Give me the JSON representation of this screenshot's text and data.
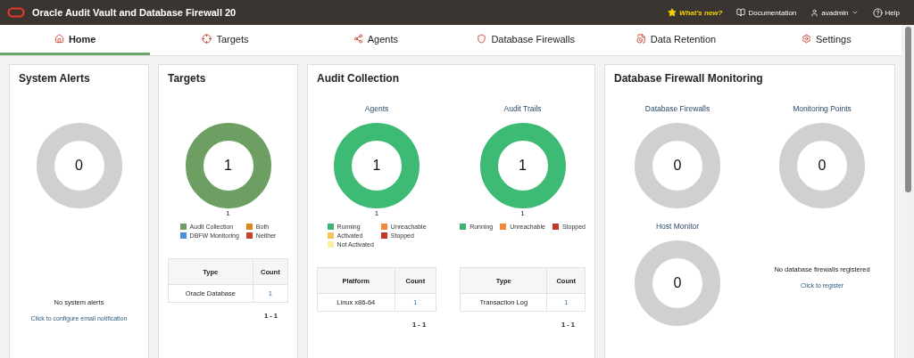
{
  "header": {
    "title": "Oracle Audit Vault and Database Firewall 20",
    "links": [
      {
        "label": "What's new?",
        "kind": "whats_new"
      },
      {
        "label": "Documentation",
        "kind": "docs"
      },
      {
        "label": "avadmin",
        "kind": "user"
      },
      {
        "label": "Help",
        "kind": "help"
      }
    ]
  },
  "tabs": [
    {
      "label": "Home",
      "kind": "home",
      "selected": true
    },
    {
      "label": "Targets",
      "kind": "targets",
      "selected": false
    },
    {
      "label": "Agents",
      "kind": "agents",
      "selected": false
    },
    {
      "label": "Database Firewalls",
      "kind": "firewalls",
      "selected": false
    },
    {
      "label": "Data Retention",
      "kind": "retention",
      "selected": false
    },
    {
      "label": "Settings",
      "kind": "settings",
      "selected": false
    }
  ],
  "system_alerts": {
    "title": "System Alerts",
    "donut": {
      "value": "0",
      "kind": "empty"
    },
    "message": "No system alerts",
    "link": "Click to configure email notification"
  },
  "targets": {
    "title": "Targets",
    "donut": {
      "value": "1",
      "kind": "targets",
      "caption": "1"
    },
    "legend": [
      {
        "label": "Audit Collection",
        "color": "#6e9f62"
      },
      {
        "label": "Both",
        "color": "#d98a1c"
      },
      {
        "label": "DBFW Monitoring",
        "color": "#4a90d9"
      },
      {
        "label": "Neither",
        "color": "#c9402f"
      }
    ],
    "table": {
      "columns": [
        "Type",
        "Count"
      ],
      "rows": [
        [
          "Oracle Database",
          "1"
        ]
      ]
    },
    "pager": "1 - 1"
  },
  "audit_collection": {
    "title": "Audit Collection",
    "sections": [
      {
        "subtitle": "Agents",
        "donut": {
          "value": "1",
          "kind": "healthy",
          "caption": "1"
        },
        "legend": [
          {
            "label": "Running",
            "color": "#3cb371"
          },
          {
            "label": "Unreachable",
            "color": "#f28a3c"
          },
          {
            "label": "Activated",
            "color": "#f5c55a"
          },
          {
            "label": "Stopped",
            "color": "#c0392b"
          },
          {
            "label": "Not Activated",
            "color": "#fbf0a0"
          }
        ],
        "table": {
          "columns": [
            "Platform",
            "Count"
          ],
          "rows": [
            [
              "Linux x86-64",
              "1"
            ]
          ]
        },
        "pager": "1 - 1"
      },
      {
        "subtitle": "Audit Trails",
        "donut": {
          "value": "1",
          "kind": "healthy",
          "caption": "1"
        },
        "legend": [
          {
            "label": "Running",
            "color": "#3cb371"
          },
          {
            "label": "Unreachable",
            "color": "#f28a3c"
          },
          {
            "label": "Stopped",
            "color": "#c0392b"
          }
        ],
        "table": {
          "columns": [
            "Type",
            "Count"
          ],
          "rows": [
            [
              "Transaction Log",
              "1"
            ]
          ]
        },
        "pager": "1 - 1"
      }
    ]
  },
  "firewall_monitoring": {
    "title": "Database Firewall Monitoring",
    "donuts": [
      {
        "subtitle": "Database Firewalls",
        "value": "0",
        "kind": "empty"
      },
      {
        "subtitle": "Monitoring Points",
        "value": "0",
        "kind": "empty"
      },
      {
        "subtitle": "Host Monitor",
        "value": "0",
        "kind": "empty"
      }
    ],
    "message": "No database firewalls registered",
    "link": "Click to register"
  }
}
